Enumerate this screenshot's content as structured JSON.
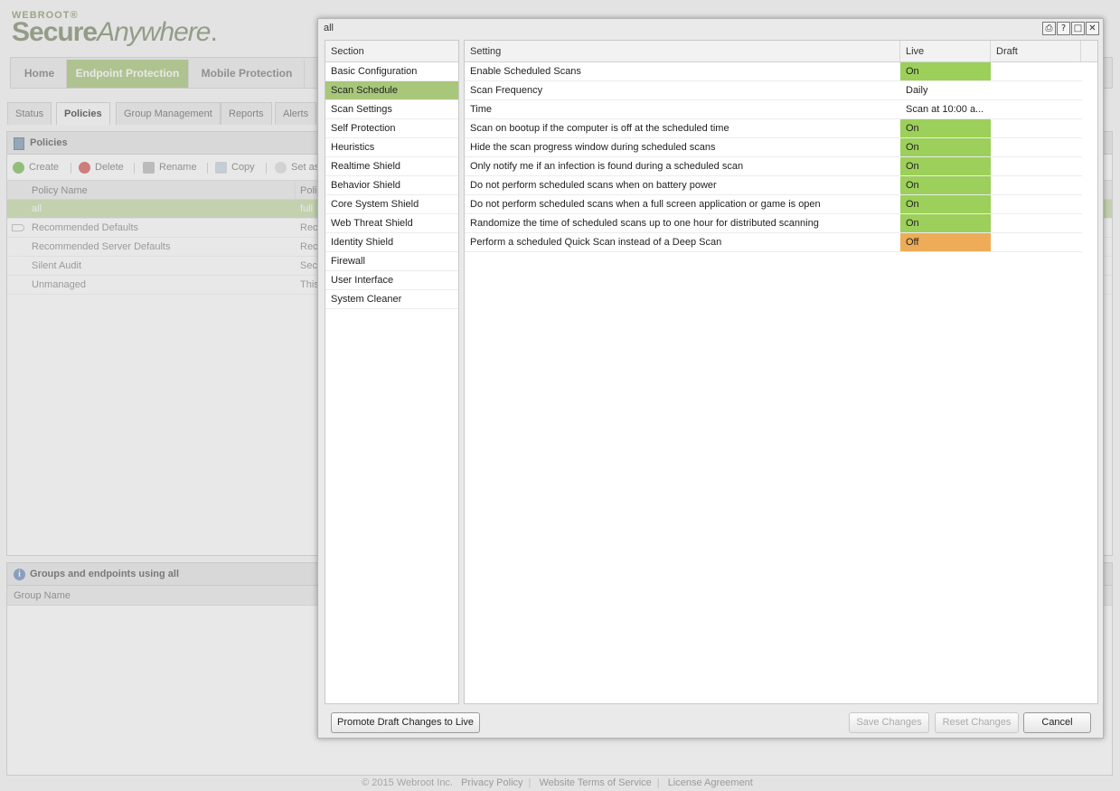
{
  "logo": {
    "brand": "WEBROOT®",
    "product_bold": "Secure",
    "product_italic": "Anywhere",
    "product_suffix": "."
  },
  "main_tabs": [
    {
      "label": "Home"
    },
    {
      "label": "Endpoint Protection"
    },
    {
      "label": "Mobile Protection"
    }
  ],
  "sub_tabs": [
    {
      "label": "Status"
    },
    {
      "label": "Policies"
    },
    {
      "label": "Group Management"
    },
    {
      "label": "Reports"
    },
    {
      "label": "Alerts"
    }
  ],
  "policies_panel": {
    "title": "Policies",
    "toolbar": {
      "create": "Create",
      "delete": "Delete",
      "rename": "Rename",
      "copy": "Copy",
      "set_as": "Set as"
    },
    "columns": {
      "name": "Policy Name",
      "desc": "Polic"
    },
    "rows": [
      {
        "name": "all",
        "desc": "full"
      },
      {
        "name": "Recommended Defaults",
        "desc": "Reco"
      },
      {
        "name": "Recommended Server Defaults",
        "desc": "Reco"
      },
      {
        "name": "Silent Audit",
        "desc": "Secu"
      },
      {
        "name": "Unmanaged",
        "desc": "This"
      }
    ]
  },
  "groups_panel": {
    "title": "Groups and endpoints using all",
    "column": "Group Name"
  },
  "footer": {
    "copyright": "© 2015 Webroot Inc.",
    "privacy": "Privacy Policy",
    "terms": "Website Terms of Service",
    "license": "License Agreement"
  },
  "dialog": {
    "title": "all",
    "section_header": "Section",
    "sections": [
      "Basic Configuration",
      "Scan Schedule",
      "Scan Settings",
      "Self Protection",
      "Heuristics",
      "Realtime Shield",
      "Behavior Shield",
      "Core System Shield",
      "Web Threat Shield",
      "Identity Shield",
      "Firewall",
      "User Interface",
      "System Cleaner"
    ],
    "selected_section": "Scan Schedule",
    "settings_header": {
      "setting": "Setting",
      "live": "Live",
      "draft": "Draft"
    },
    "settings": [
      {
        "name": "Enable Scheduled Scans",
        "live": "On",
        "state": "on"
      },
      {
        "name": "Scan Frequency",
        "live": "Daily",
        "state": "text"
      },
      {
        "name": "Time",
        "live": "Scan at 10:00 a...",
        "state": "text"
      },
      {
        "name": "Scan on bootup if the computer is off at the scheduled time",
        "live": "On",
        "state": "on"
      },
      {
        "name": "Hide the scan progress window during scheduled scans",
        "live": "On",
        "state": "on"
      },
      {
        "name": "Only notify me if an infection is found during a scheduled scan",
        "live": "On",
        "state": "on"
      },
      {
        "name": "Do not perform scheduled scans when on battery power",
        "live": "On",
        "state": "on"
      },
      {
        "name": "Do not perform scheduled scans when a full screen application or game is open",
        "live": "On",
        "state": "on"
      },
      {
        "name": "Randomize the time of scheduled scans up to one hour for distributed scanning",
        "live": "On",
        "state": "on"
      },
      {
        "name": "Perform a scheduled Quick Scan instead of a Deep Scan",
        "live": "Off",
        "state": "off"
      }
    ],
    "buttons": {
      "promote": "Promote Draft Changes to Live",
      "save": "Save Changes",
      "reset": "Reset Changes",
      "cancel": "Cancel"
    }
  },
  "colors": {
    "accent_green": "#a8c77a",
    "on_green": "#9cd05a",
    "off_orange": "#eeac58"
  }
}
